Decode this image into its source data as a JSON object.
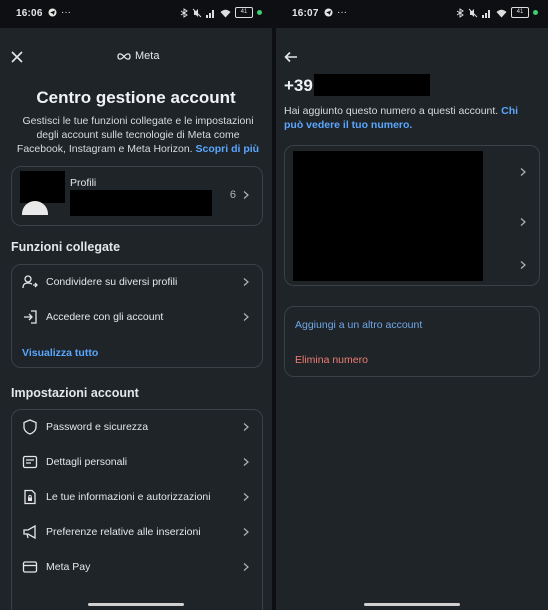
{
  "left": {
    "status": {
      "time": "16:06",
      "battery": "41"
    },
    "brand": "Meta",
    "title": "Centro gestione account",
    "description": "Gestisci le tue funzioni collegate e le impostazioni degli account sulle tecnologie di Meta come Facebook, Instagram e Meta Horizon.",
    "description_link": "Scopri di più",
    "profiles": {
      "label": "Profili",
      "count": "6"
    },
    "linked_section": {
      "title": "Funzioni collegate",
      "items": [
        {
          "label": "Condividere su diversi profili",
          "icon": "people-share-icon"
        },
        {
          "label": "Accedere con gli account",
          "icon": "login-arrow-icon"
        }
      ],
      "view_all": "Visualizza tutto"
    },
    "account_section": {
      "title": "Impostazioni account",
      "items": [
        {
          "label": "Password e sicurezza",
          "icon": "shield-icon"
        },
        {
          "label": "Dettagli personali",
          "icon": "id-card-icon"
        },
        {
          "label": "Le tue informazioni e autorizzazioni",
          "icon": "document-lock-icon"
        },
        {
          "label": "Preferenze relative alle inserzioni",
          "icon": "megaphone-icon"
        },
        {
          "label": "Meta Pay",
          "icon": "credit-card-icon"
        }
      ]
    }
  },
  "right": {
    "status": {
      "time": "16:07",
      "battery": "41"
    },
    "phone_prefix": "+39",
    "description": "Hai aggiunto questo numero a questi account.",
    "description_link": "Chi può vedere il tuo numero.",
    "actions": {
      "add_account": "Aggiungi a un altro account",
      "delete_number": "Elimina numero"
    },
    "colors": {
      "link": "#5aa7ff",
      "danger": "#f07d72",
      "background": "#1f2428"
    }
  }
}
